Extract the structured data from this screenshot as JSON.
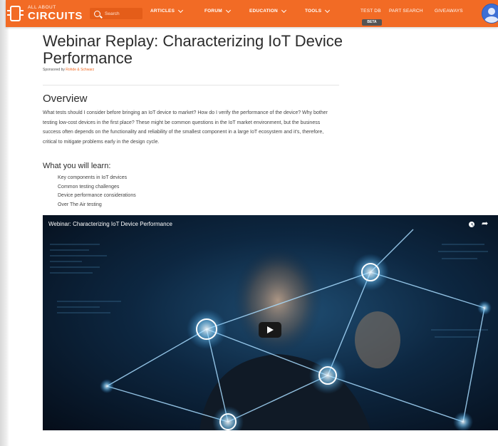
{
  "nav": {
    "logo_small": "ALL ABOUT",
    "logo_big": "CIRCUITS",
    "search_placeholder": "Search",
    "items": [
      {
        "label": "ARTICLES",
        "dropdown": true
      },
      {
        "label": "FORUM",
        "dropdown": true
      },
      {
        "label": "EDUCATION",
        "dropdown": true
      },
      {
        "label": "TOOLS",
        "dropdown": true
      },
      {
        "label": "TEST DB",
        "dropdown": false
      },
      {
        "label": "PART SEARCH",
        "dropdown": false
      },
      {
        "label": "GIVEAWAYS",
        "dropdown": false
      }
    ],
    "beta_badge": "BETA",
    "brand_color": "#f26b25"
  },
  "article": {
    "title": "Webinar Replay: Characterizing IoT Device Performance",
    "sponsor_prefix": "Sponsored by",
    "sponsor_name": "Rohde & Schwarz",
    "overview_heading": "Overview",
    "overview_text": "What tests should I consider before bringing an IoT device to market? How do I verify the performance of the device? Why bother testing low-cost devices in the first place? These might be common questions in the IoT market environment, but the business success often depends on the functionality and reliability of the smallest component in a large IoT ecosystem and it's, therefore, critical to mitigate problems early in the design cycle.",
    "learn_heading": "What you will learn:",
    "learn_items": [
      "Key components in IoT devices",
      "Common testing challenges",
      "Device performance considerations",
      "Over The Air testing"
    ]
  },
  "video": {
    "title": "Webinar: Characterizing IoT Device Performance"
  }
}
